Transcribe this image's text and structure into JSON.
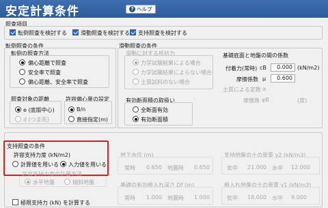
{
  "header": {
    "title": "安定計算条件",
    "help_label": "ヘルプ"
  },
  "check_items": {
    "heading": "照査項目",
    "items": [
      {
        "label": "転倒照査を検討する",
        "checked": true
      },
      {
        "label": "滑動照査を検討する",
        "checked": true
      },
      {
        "label": "支持照査を検討する",
        "checked": true
      }
    ]
  },
  "overturn": {
    "heading": "転倒照査の条件",
    "method_heading": "転倒の照査方法",
    "methods": [
      "偏心距離で照査",
      "安全率で照査",
      "偏心距離、安全率で照査"
    ],
    "target_heading": "照査対象の距離",
    "targets": [
      "e (底版中心)",
      "d (つま先)"
    ],
    "allow_heading": "許容偏心量の設定",
    "allows": [
      "B/n",
      "直接指定(m)"
    ]
  },
  "sliding": {
    "heading": "滑動照査の条件",
    "resist_heading": "滑動に対する抵抗力",
    "resists": [
      "力学試験結果による場合",
      "力学試験結果によらない場合",
      "土質試料のない場合"
    ],
    "valid_heading": "有効断面積の取扱い",
    "valids": [
      "全断面有効",
      "有効断面積"
    ]
  },
  "friction": {
    "heading": "基礎底面と地盤の間の係数",
    "adhesion_label": "付着力(常時)",
    "adhesion_symbol": "cB",
    "adhesion_value": "0.000",
    "adhesion_unit": "(kN/m2)",
    "coef_label": "摩擦係数",
    "coef_symbol": "μ",
    "coef_value": "0.600",
    "soil_label": "土質による定数",
    "soil_symbol": "α",
    "angle_label": "摩擦角",
    "angle_symbol": "φB",
    "angle_unit": "(度)"
  },
  "bearing": {
    "heading": "支持照査の条件",
    "allow_heading": "許容支持力度 (kN/m2)",
    "options": [
      "計算値を用いる",
      "入力値を用いる"
    ],
    "method_heading": "許容支持力度の計算方法",
    "methods": [
      "水平地盤",
      "傾斜地盤"
    ],
    "ultimate_label": "極限支持力 (kN) を計算する"
  },
  "groundwater": {
    "heading": "地下水位 (m)",
    "normal_label": "常時",
    "normal_value": "0.650",
    "quake_label": "地震時",
    "quake_value": "0.650"
  },
  "unit_weight2": {
    "heading": "支持地盤の土の単重 γ2 (kN/m3)",
    "air_label": "気中",
    "air_value": "21.000",
    "water_label": "水中",
    "water_value": "12.000"
  },
  "embed": {
    "heading": "基礎の有効根入れ深さ Df (m)",
    "normal_label": "常時",
    "normal_value": "1.000",
    "quake_label": "地震時",
    "quake_value": "1.000"
  },
  "unit_weight1": {
    "heading": "根入れ地盤の土の単重 γ1 (kN/m3)",
    "air_label": "気中",
    "air_value": "18.000",
    "water_label": "水中",
    "water_value": "9.000"
  }
}
